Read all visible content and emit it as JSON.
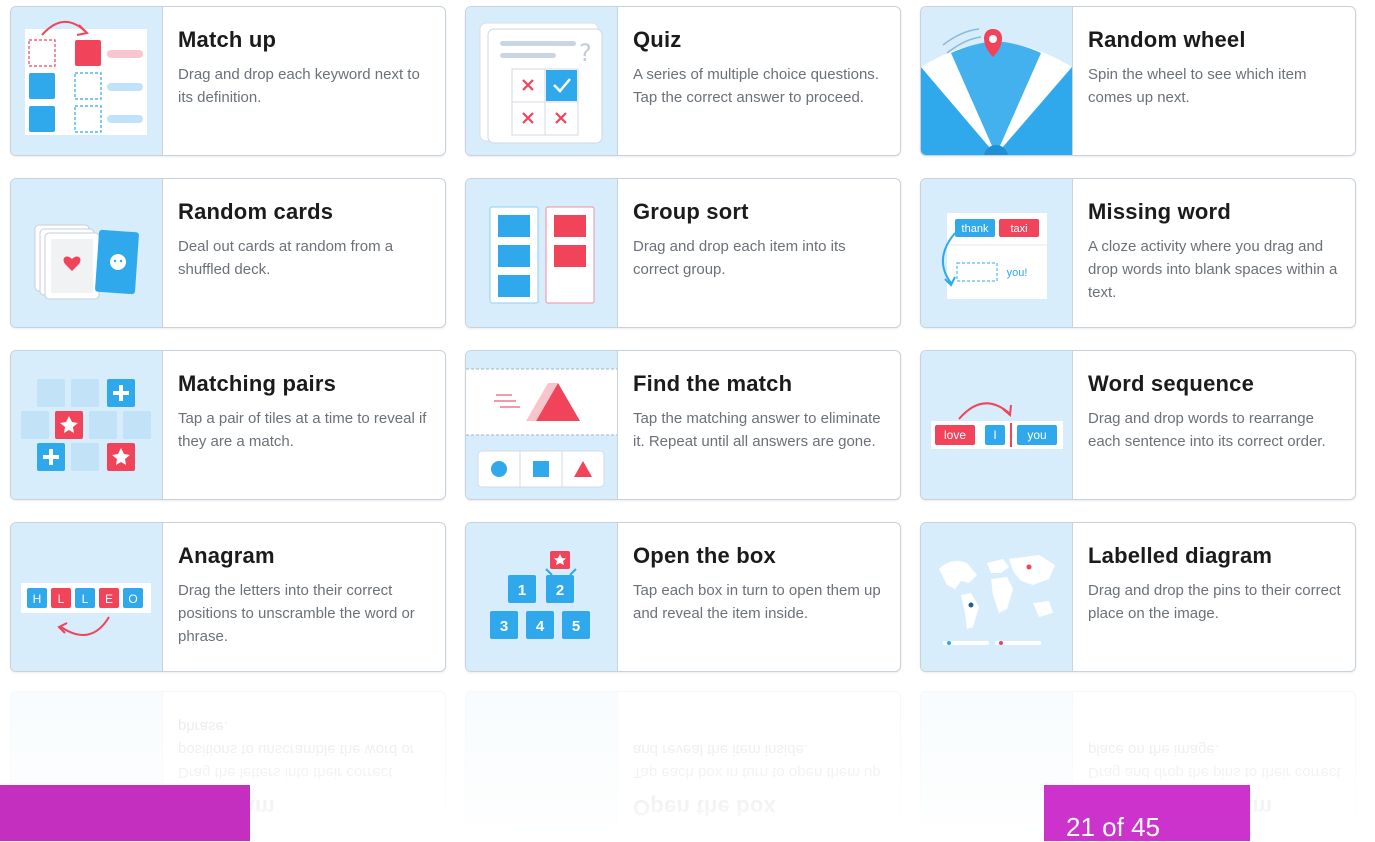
{
  "templates": [
    {
      "title": "Match up",
      "description": "Drag and drop each keyword next to its definition."
    },
    {
      "title": "Quiz",
      "description": "A series of multiple choice questions. Tap the correct answer to proceed."
    },
    {
      "title": "Random wheel",
      "description": "Spin the wheel to see which item comes up next."
    },
    {
      "title": "Random cards",
      "description": "Deal out cards at random from a shuffled deck."
    },
    {
      "title": "Group sort",
      "description": "Drag and drop each item into its correct group."
    },
    {
      "title": "Missing word",
      "description": "A cloze activity where you drag and drop words into blank spaces within a text."
    },
    {
      "title": "Matching pairs",
      "description": "Tap a pair of tiles at a time to reveal if they are a match."
    },
    {
      "title": "Find the match",
      "description": "Tap the matching answer to eliminate it. Repeat until all answers are gone."
    },
    {
      "title": "Word sequence",
      "description": "Drag and drop words to rearrange each sentence into its correct order."
    },
    {
      "title": "Anagram",
      "description": "Drag the letters into their correct positions to unscramble the word or phrase."
    },
    {
      "title": "Open the box",
      "description": "Tap each box in turn to open them up and reveal the item inside."
    },
    {
      "title": "Labelled diagram",
      "description": "Drag and drop the pins to their correct place on the image."
    }
  ],
  "thumb_text": {
    "missing_word": {
      "word1": "thank",
      "word2": "taxi",
      "word3": "you!"
    },
    "word_sequence": {
      "word1": "love",
      "word2": "I",
      "word3": "you"
    },
    "anagram_letters": [
      "H",
      "L",
      "L",
      "E",
      "O"
    ],
    "open_box_numbers": [
      "1",
      "2",
      "3",
      "4",
      "5"
    ],
    "quiz_glyph": "?"
  },
  "pagination": {
    "current": "21",
    "of_label": "of",
    "total": "45"
  },
  "colors": {
    "blue": "#2fa8ec",
    "red": "#f1435a",
    "thumb_bg": "#d7edfb",
    "magenta": "#cc33cc"
  },
  "icons": [
    "match-up-icon",
    "quiz-icon",
    "random-wheel-icon",
    "random-cards-icon",
    "group-sort-icon",
    "missing-word-icon",
    "matching-pairs-icon",
    "find-the-match-icon",
    "word-sequence-icon",
    "anagram-icon",
    "open-the-box-icon",
    "labelled-diagram-icon"
  ]
}
